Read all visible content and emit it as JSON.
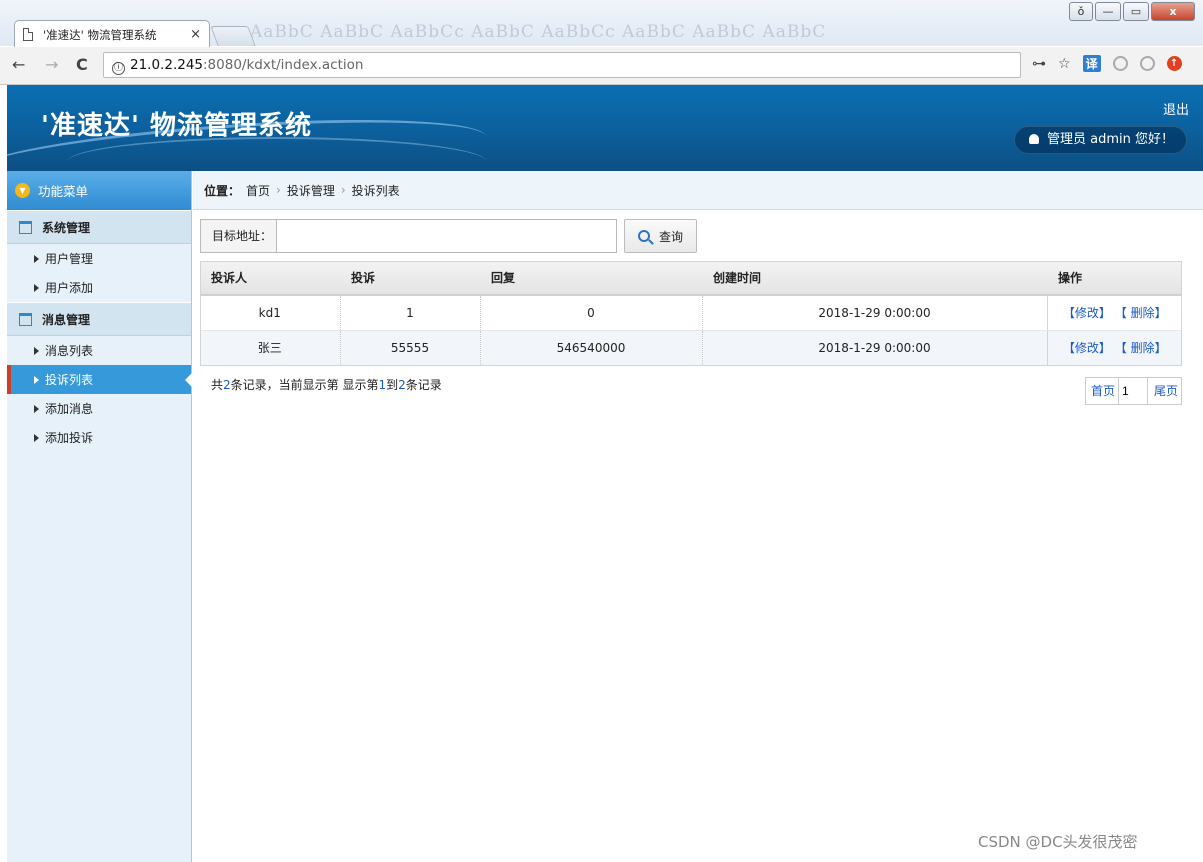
{
  "browser": {
    "tab_title": "'准速达' 物流管理系统",
    "tab_close": "×",
    "ghost_text": "AaBbC AaBbC AaBbCc AaBbC AaBbCc AaBbC AaBbC AaBbC",
    "url_host": "21.0.2.245",
    "url_path": ":8080/kdxt/index.action",
    "info_icon": "ⓘ",
    "back": "←",
    "forward": "→",
    "reload": "C",
    "key_icon": "⊶",
    "star_icon": "☆",
    "translate_icon": "译",
    "ext_icon_red": "↑",
    "win_restore": "▭",
    "win_min": "—",
    "win_close": "x",
    "win_user": "ǒ"
  },
  "header": {
    "title": "'准速达' 物流管理系统",
    "logout": "退出",
    "welcome": "管理员 admin 您好！"
  },
  "sidebar": {
    "menu_title": "功能菜单",
    "menu_icon": "▼",
    "groups": [
      {
        "label": "系统管理",
        "items": [
          "用户管理",
          "用户添加"
        ]
      },
      {
        "label": "消息管理",
        "items": [
          "消息列表",
          "投诉列表",
          "添加消息",
          "添加投诉"
        ]
      }
    ],
    "active_item": "投诉列表"
  },
  "breadcrumb": {
    "label": "位置：",
    "items": [
      "首页",
      "投诉管理",
      "投诉列表"
    ],
    "sep": "›"
  },
  "search": {
    "label": "目标地址：",
    "value": "",
    "button": "查询"
  },
  "table": {
    "columns": [
      "投诉人",
      "投诉",
      "回复",
      "创建时间",
      "操作"
    ],
    "rows": [
      {
        "person": "kd1",
        "complaint": "1",
        "reply": "0",
        "created": "2018-1-29 0:00:00",
        "edit": "【修改】",
        "delete": "【 删除】"
      },
      {
        "person": "张三",
        "complaint": "55555",
        "reply": "546540000",
        "created": "2018-1-29 0:00:00",
        "edit": "【修改】",
        "delete": "【 删除】"
      }
    ]
  },
  "footer": {
    "total_prefix": "共",
    "total": "2",
    "total_mid": "条记录，当前显示第  显示第",
    "from": "1",
    "to_word": "到",
    "to": "2",
    "suffix": "条记录"
  },
  "pager": {
    "first": "首页",
    "page": "1",
    "last": "尾页"
  },
  "watermark": "CSDN @DC头发很茂密",
  "colors": {
    "header_blue": "#0a6fb3",
    "sidebar_bg": "#e6f1fa",
    "active_blue": "#3699d9",
    "link_blue": "#1a59c9",
    "active_marker": "#d03c2a"
  }
}
